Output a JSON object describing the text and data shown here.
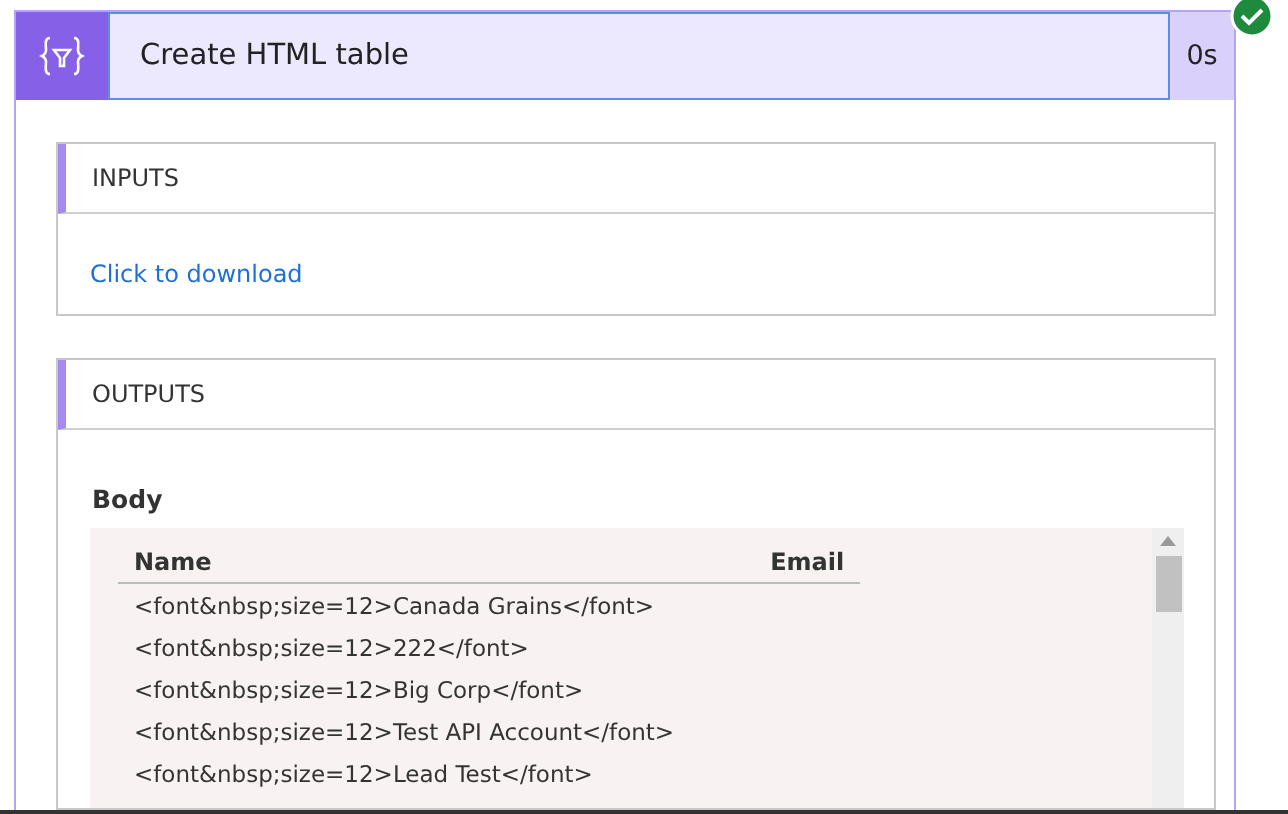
{
  "action": {
    "title": "Create HTML table",
    "duration": "0s",
    "succeeded": true
  },
  "inputs": {
    "heading": "INPUTS",
    "link": "Click to download"
  },
  "outputs": {
    "heading": "OUTPUTS",
    "body_label": "Body",
    "table": {
      "columns": [
        "Name",
        "Email"
      ],
      "rows": [
        [
          "<font&nbsp;size=12>Canada Grains</font>",
          ""
        ],
        [
          "<font&nbsp;size=12>222</font>",
          ""
        ],
        [
          "<font&nbsp;size=12>Big Corp</font>",
          ""
        ],
        [
          "<font&nbsp;size=12>Test API Account</font>",
          ""
        ],
        [
          "<font&nbsp;size=12>Lead Test</font>",
          ""
        ]
      ]
    }
  }
}
